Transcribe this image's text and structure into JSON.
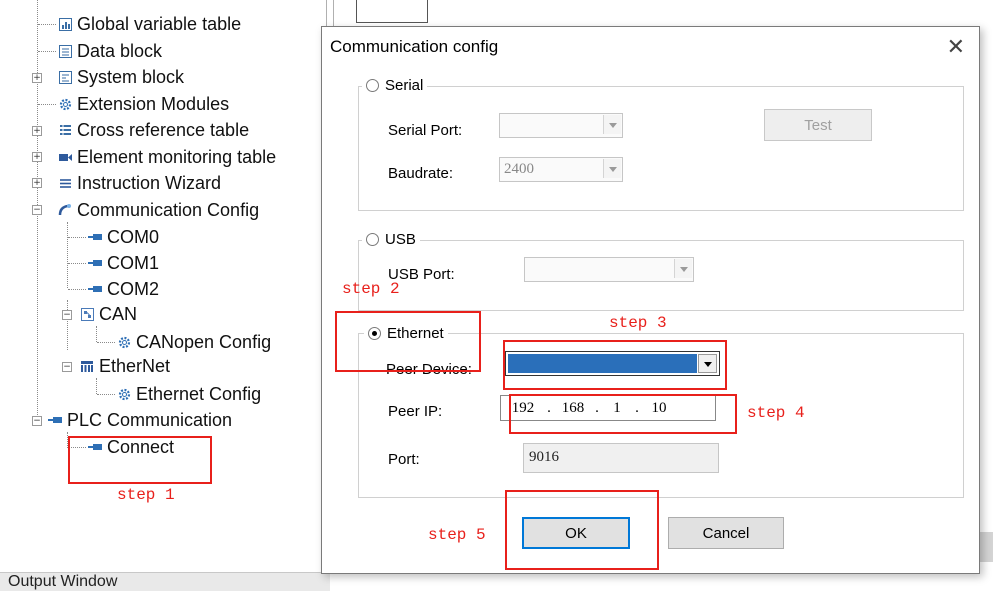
{
  "tree": {
    "items": [
      {
        "label": "Global variable table",
        "icon": "table-chart-icon"
      },
      {
        "label": "Data block",
        "icon": "data-block-icon"
      },
      {
        "label": "System block",
        "icon": "system-block-icon"
      },
      {
        "label": "Extension Modules",
        "icon": "gear-icon"
      },
      {
        "label": "Cross reference table",
        "icon": "list-table-icon"
      },
      {
        "label": "Element monitoring table",
        "icon": "monitor-icon"
      },
      {
        "label": "Instruction Wizard",
        "icon": "wizard-lines-icon"
      },
      {
        "label": "Communication Config",
        "icon": "communication-icon"
      },
      {
        "label": "COM0",
        "icon": "plug-icon"
      },
      {
        "label": "COM1",
        "icon": "plug-icon"
      },
      {
        "label": "COM2",
        "icon": "plug-icon"
      },
      {
        "label": "CAN",
        "icon": "can-network-icon"
      },
      {
        "label": "CANopen Config",
        "icon": "gear-icon"
      },
      {
        "label": "EtherNet",
        "icon": "ethernet-icon"
      },
      {
        "label": "Ethernet Config",
        "icon": "gear-icon"
      },
      {
        "label": "PLC Communication",
        "icon": "plug-icon"
      },
      {
        "label": "Connect",
        "icon": "plug-icon"
      }
    ]
  },
  "output_window": {
    "label": "Output Window"
  },
  "dialog": {
    "title": "Communication config",
    "serial": {
      "legend": "Serial",
      "port_label": "Serial Port:",
      "port_value": "",
      "baud_label": "Baudrate:",
      "baud_value": "2400",
      "test_label": "Test"
    },
    "usb": {
      "legend": "USB",
      "port_label": "USB Port:",
      "port_value": ""
    },
    "ethernet": {
      "legend": "Ethernet",
      "selected": true,
      "peer_device_label": "Peer Device:",
      "peer_ip_label": "Peer IP:",
      "ip": [
        "192",
        "168",
        "1",
        "10"
      ],
      "port_label": "Port:",
      "port_value": "9016"
    },
    "ok_label": "OK",
    "cancel_label": "Cancel"
  },
  "annotations": {
    "step1": "step 1",
    "step2": "step 2",
    "step3": "step 3",
    "step4": "step 4",
    "step5": "step 5",
    "color": "#e8201b"
  }
}
